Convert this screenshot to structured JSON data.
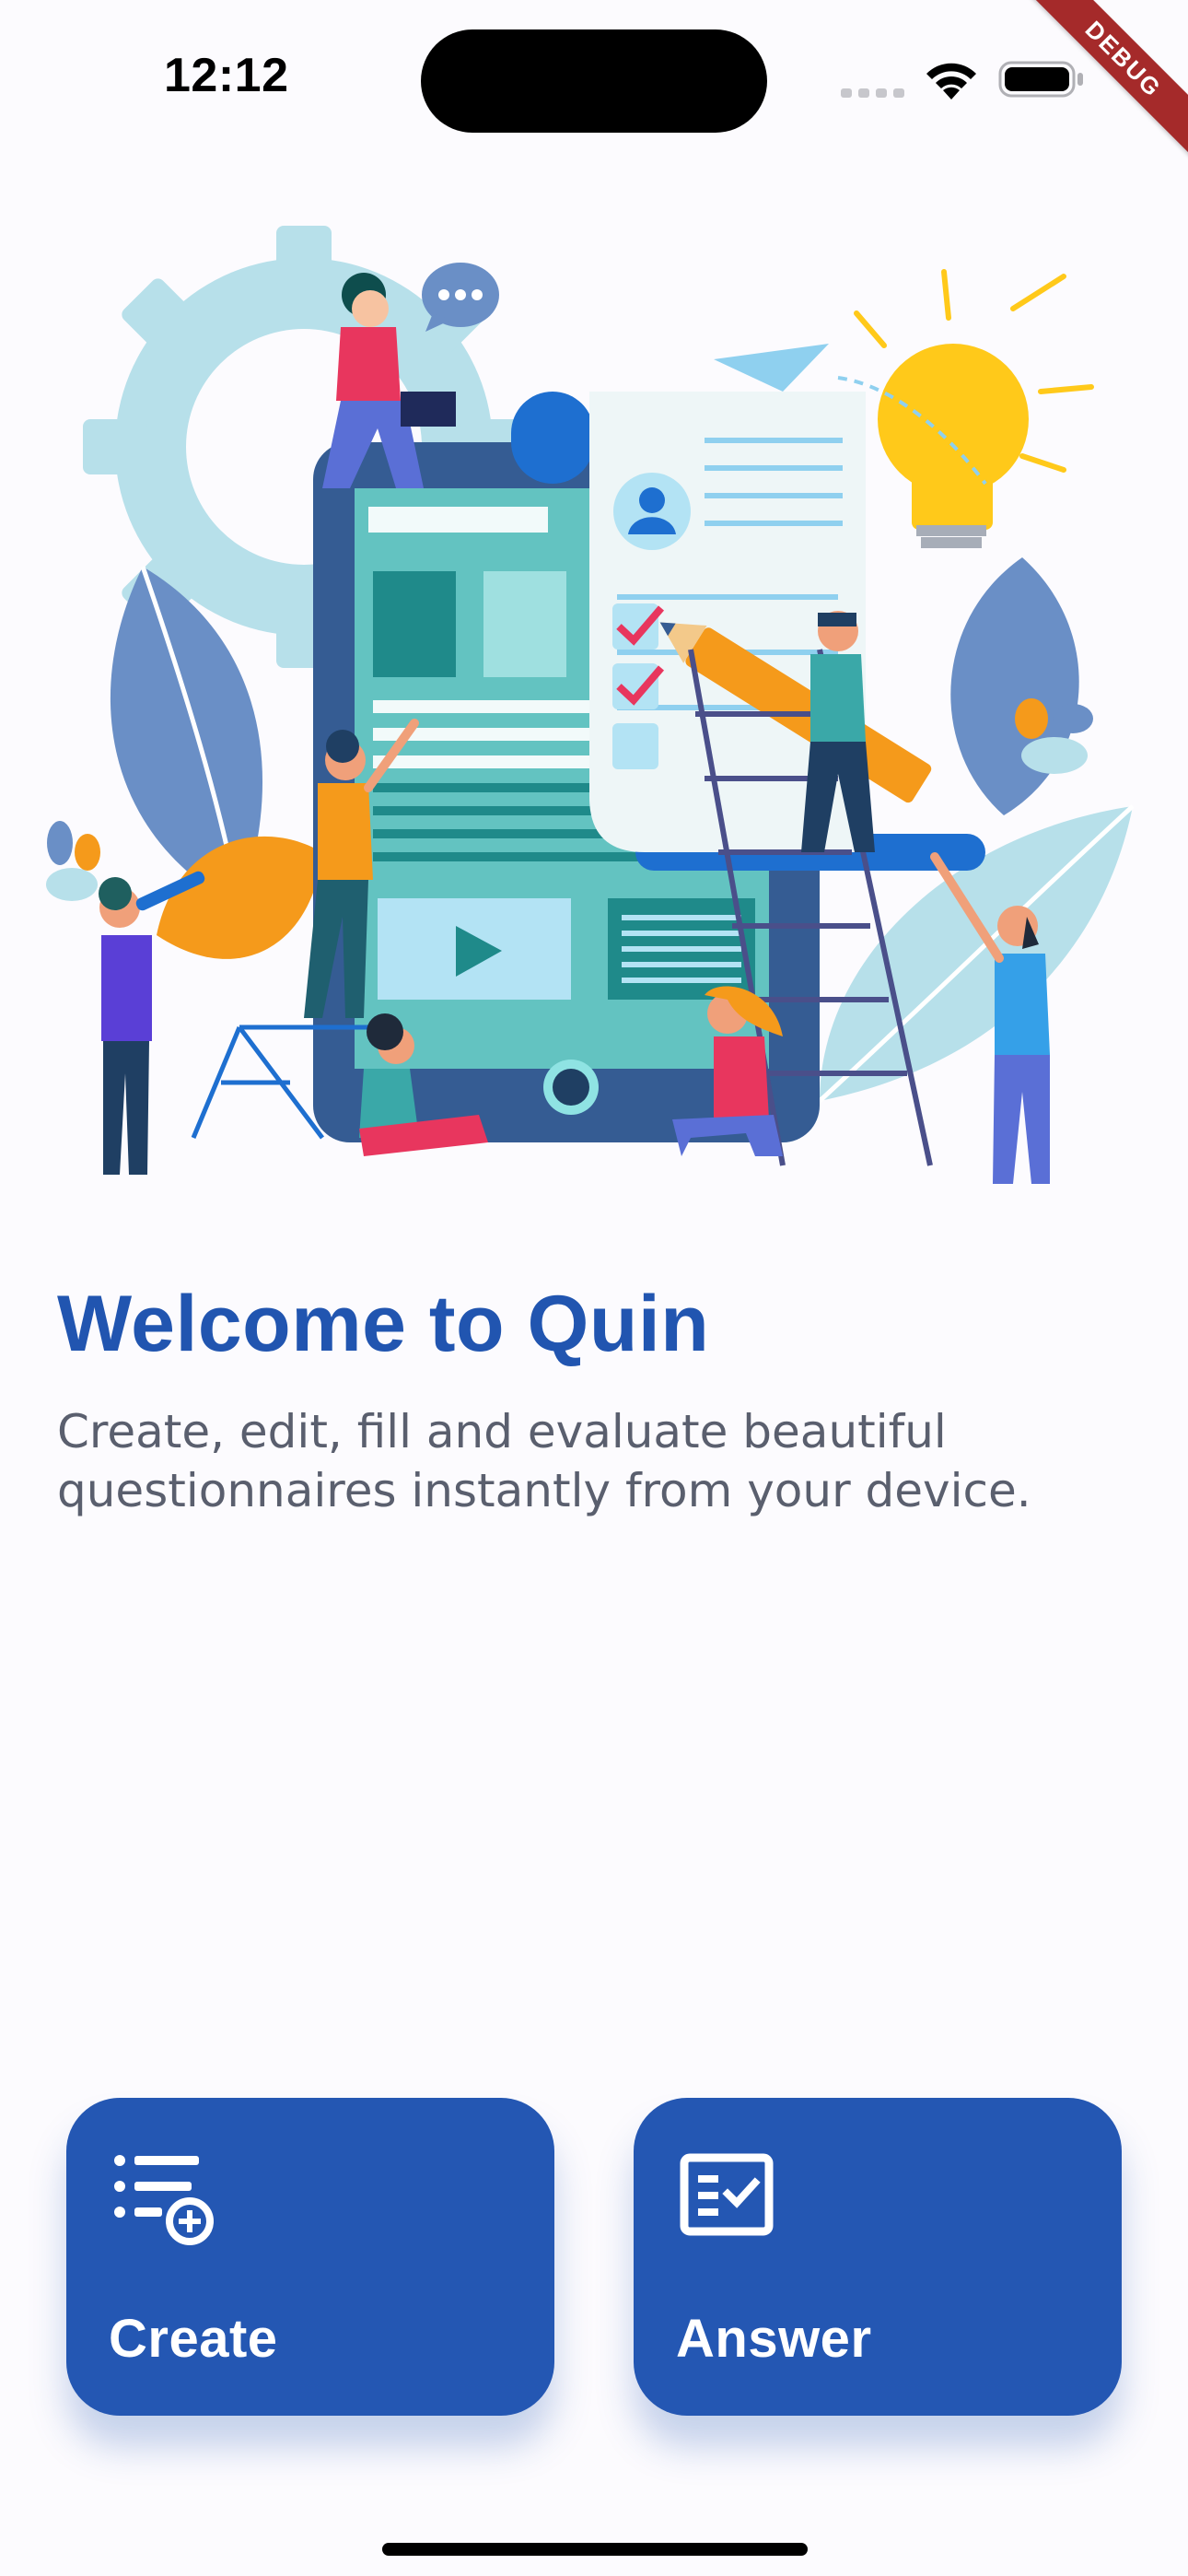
{
  "status_bar": {
    "time": "12:12"
  },
  "debug_banner": {
    "label": "DEBUG"
  },
  "welcome": {
    "title": "Welcome to Quin",
    "subtitle": "Create, edit, fill and evaluate beautiful questionnaires instantly from your device."
  },
  "actions": {
    "create": {
      "label": "Create",
      "icon": "playlist-add-icon"
    },
    "answer": {
      "label": "Answer",
      "icon": "fact-check-icon"
    }
  },
  "colors": {
    "primary": "#2457b3",
    "title": "#2155b0",
    "subtitle": "#5a5f6e",
    "background": "#fcfbfe",
    "debug": "#a52a2a"
  }
}
